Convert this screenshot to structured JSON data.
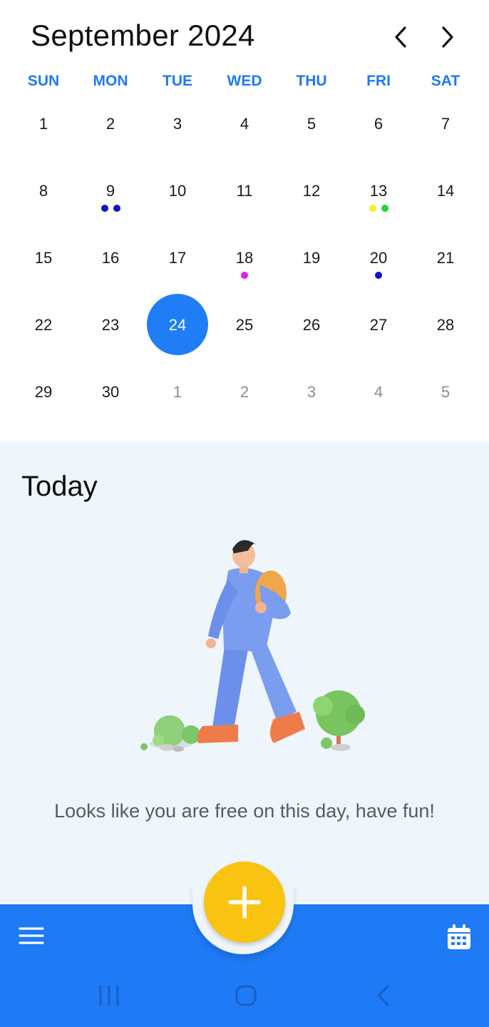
{
  "header": {
    "month_title": "September 2024",
    "prev_icon": "chevron-left-icon",
    "next_icon": "chevron-right-icon"
  },
  "weekdays": [
    "SUN",
    "MON",
    "TUE",
    "WED",
    "THU",
    "FRI",
    "SAT"
  ],
  "days": [
    {
      "label": "1",
      "muted": false,
      "dots": []
    },
    {
      "label": "2",
      "muted": false,
      "dots": []
    },
    {
      "label": "3",
      "muted": false,
      "dots": []
    },
    {
      "label": "4",
      "muted": false,
      "dots": []
    },
    {
      "label": "5",
      "muted": false,
      "dots": []
    },
    {
      "label": "6",
      "muted": false,
      "dots": []
    },
    {
      "label": "7",
      "muted": false,
      "dots": []
    },
    {
      "label": "8",
      "muted": false,
      "dots": []
    },
    {
      "label": "9",
      "muted": false,
      "dots": [
        "#1010d8",
        "#1010d8"
      ]
    },
    {
      "label": "10",
      "muted": false,
      "dots": []
    },
    {
      "label": "11",
      "muted": false,
      "dots": []
    },
    {
      "label": "12",
      "muted": false,
      "dots": []
    },
    {
      "label": "13",
      "muted": false,
      "dots": [
        "#f5f31a",
        "#21d43b"
      ]
    },
    {
      "label": "14",
      "muted": false,
      "dots": []
    },
    {
      "label": "15",
      "muted": false,
      "dots": []
    },
    {
      "label": "16",
      "muted": false,
      "dots": []
    },
    {
      "label": "17",
      "muted": false,
      "dots": []
    },
    {
      "label": "18",
      "muted": false,
      "dots": [
        "#e41ee0"
      ]
    },
    {
      "label": "19",
      "muted": false,
      "dots": []
    },
    {
      "label": "20",
      "muted": false,
      "dots": [
        "#1010d8"
      ]
    },
    {
      "label": "21",
      "muted": false,
      "dots": []
    },
    {
      "label": "22",
      "muted": false,
      "dots": []
    },
    {
      "label": "23",
      "muted": false,
      "dots": []
    },
    {
      "label": "24",
      "muted": false,
      "selected": true,
      "dots": []
    },
    {
      "label": "25",
      "muted": false,
      "dots": []
    },
    {
      "label": "26",
      "muted": false,
      "dots": []
    },
    {
      "label": "27",
      "muted": false,
      "dots": []
    },
    {
      "label": "28",
      "muted": false,
      "dots": []
    },
    {
      "label": "29",
      "muted": false,
      "dots": []
    },
    {
      "label": "30",
      "muted": false,
      "dots": []
    },
    {
      "label": "1",
      "muted": true,
      "dots": []
    },
    {
      "label": "2",
      "muted": true,
      "dots": []
    },
    {
      "label": "3",
      "muted": true,
      "dots": []
    },
    {
      "label": "4",
      "muted": true,
      "dots": []
    },
    {
      "label": "5",
      "muted": true,
      "dots": []
    }
  ],
  "today": {
    "title": "Today",
    "message": "Looks like you are free on this day, have fun!",
    "illustration": "walking-person-illustration"
  },
  "bottom_bar": {
    "menu_icon": "hamburger-menu-icon",
    "add_icon": "plus-icon",
    "calendar_icon": "calendar-icon"
  },
  "system_nav": {
    "recents_icon": "recents-icon",
    "home_icon": "home-icon",
    "back_icon": "back-icon"
  },
  "colors": {
    "accent": "#1f7ef5",
    "fab": "#f9c411",
    "panel_bg": "#eef6fb"
  }
}
